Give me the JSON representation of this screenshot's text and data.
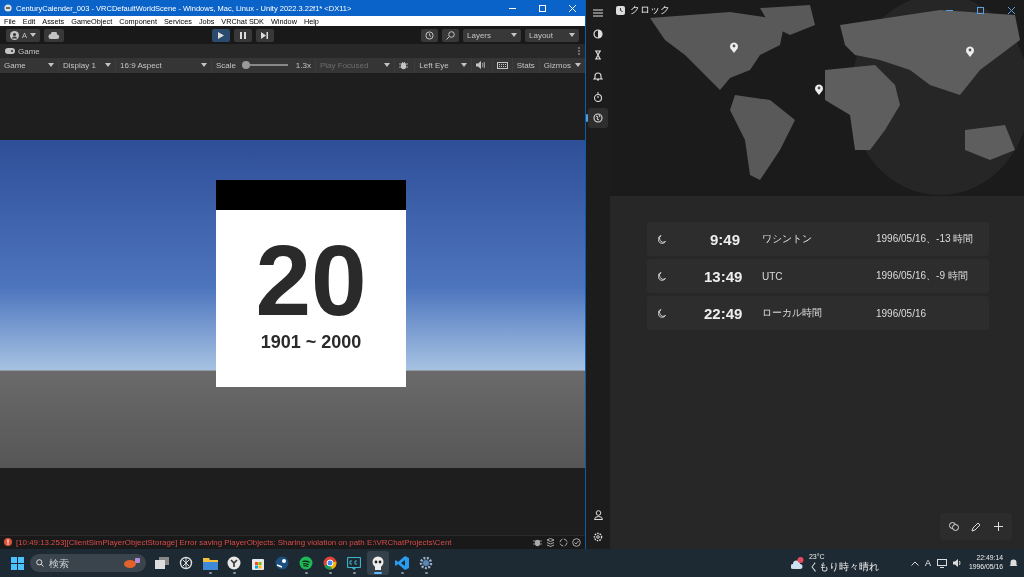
{
  "unity": {
    "title": "CenturyCalender_003 - VRCDefaultWorldScene - Windows, Mac, Linux - Unity 2022.3.22f1* <DX11>",
    "menu": [
      "File",
      "Edit",
      "Assets",
      "GameObject",
      "Component",
      "Services",
      "Jobs",
      "VRChat SDK",
      "Window",
      "Help"
    ],
    "account": "A",
    "playback": [
      {
        "kind": "play",
        "on": true
      },
      {
        "kind": "pause",
        "on": false
      },
      {
        "kind": "step",
        "on": false
      }
    ],
    "layers": "Layers",
    "layout": "Layout",
    "tab": "Game",
    "game_toolbar": {
      "mode": "Game",
      "display": "Display 1",
      "aspect": "16:9 Aspect",
      "scale_label": "Scale",
      "scale": {
        "level": 0.05
      },
      "scale_value": "1.3x",
      "play_focused": {
        "label": "Play Focused",
        "disabled": true
      },
      "eye": "Left Eye",
      "stats": "Stats",
      "gizmos": "Gizmos"
    },
    "calendar": {
      "number": "20",
      "range": "1901 ~ 2000"
    },
    "console": {
      "message": "[10:49:13.253][ClientSimPlayerObjectStorage] Error saving PlayerObjects: Sharing violation on path E:\\VRChatProjects\\Cent"
    }
  },
  "clock": {
    "title": "クロック",
    "nav": [
      {
        "kind": "focus",
        "selected": false
      },
      {
        "kind": "timer",
        "selected": false
      },
      {
        "kind": "alarm",
        "selected": false
      },
      {
        "kind": "stopwatch",
        "selected": false
      },
      {
        "kind": "world",
        "selected": true
      }
    ],
    "cities": [
      {
        "time": "9:49",
        "place": "ワシントン",
        "date": "1996/05/16、-13 時間"
      },
      {
        "time": "13:49",
        "place": "UTC",
        "date": "1996/05/16、-9 時間"
      },
      {
        "time": "22:49",
        "place": "ローカル時間",
        "date": "1996/05/16"
      }
    ]
  },
  "taskbar": {
    "search": {
      "placeholder": "検索"
    },
    "apps": [
      {
        "kind": "taskview",
        "running": false,
        "active": false
      },
      {
        "kind": "knot",
        "running": false,
        "active": false
      },
      {
        "kind": "folder",
        "running": true,
        "active": false
      },
      {
        "kind": "round",
        "running": true,
        "active": false
      },
      {
        "kind": "store",
        "running": false,
        "active": false
      },
      {
        "kind": "steam",
        "running": false,
        "active": false
      },
      {
        "kind": "music",
        "running": true,
        "active": false
      },
      {
        "kind": "browser",
        "running": true,
        "active": false
      },
      {
        "kind": "captions",
        "running": true,
        "active": false
      },
      {
        "kind": "unity",
        "running": true,
        "active": true
      },
      {
        "kind": "code",
        "running": true,
        "active": false
      },
      {
        "kind": "gear",
        "running": true,
        "active": false
      }
    ],
    "weather": {
      "temp": "23°C",
      "condition": "くもり時々晴れ"
    },
    "ime": "A",
    "time": "22:49:14",
    "date": "1996/05/16"
  }
}
